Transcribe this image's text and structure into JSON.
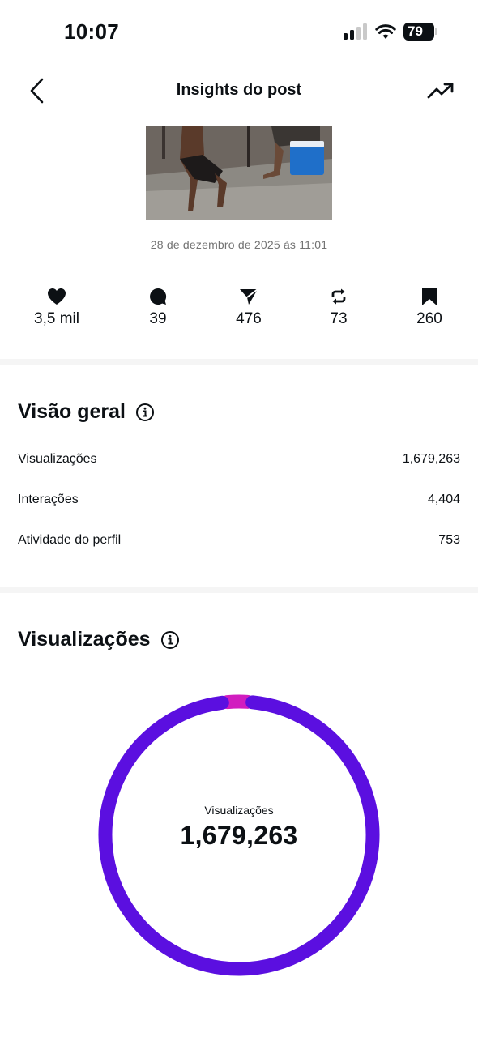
{
  "status_bar": {
    "time": "10:07",
    "battery": "79"
  },
  "header": {
    "title": "Insights do post"
  },
  "post": {
    "date": "28 de dezembro de 2025 às 11:01"
  },
  "metrics": [
    {
      "icon": "heart-icon",
      "value": "3,5 mil"
    },
    {
      "icon": "comment-icon",
      "value": "39"
    },
    {
      "icon": "share-icon",
      "value": "476"
    },
    {
      "icon": "repost-icon",
      "value": "73"
    },
    {
      "icon": "bookmark-icon",
      "value": "260"
    }
  ],
  "overview": {
    "title": "Visão geral",
    "rows": [
      {
        "label": "Visualizações",
        "value": "1,679,263"
      },
      {
        "label": "Interações",
        "value": "4,404"
      },
      {
        "label": "Atividade do perfil",
        "value": "753"
      }
    ]
  },
  "views": {
    "title": "Visualizações",
    "donut_label": "Visualizações",
    "donut_value": "1,679,263",
    "segments": [
      {
        "fraction": 0.97,
        "color": "#5b0fe0"
      },
      {
        "fraction": 0.03,
        "color": "#d11dbf"
      }
    ]
  },
  "colors": {
    "accent": "#5b0fe0",
    "secondary": "#d11dbf"
  }
}
